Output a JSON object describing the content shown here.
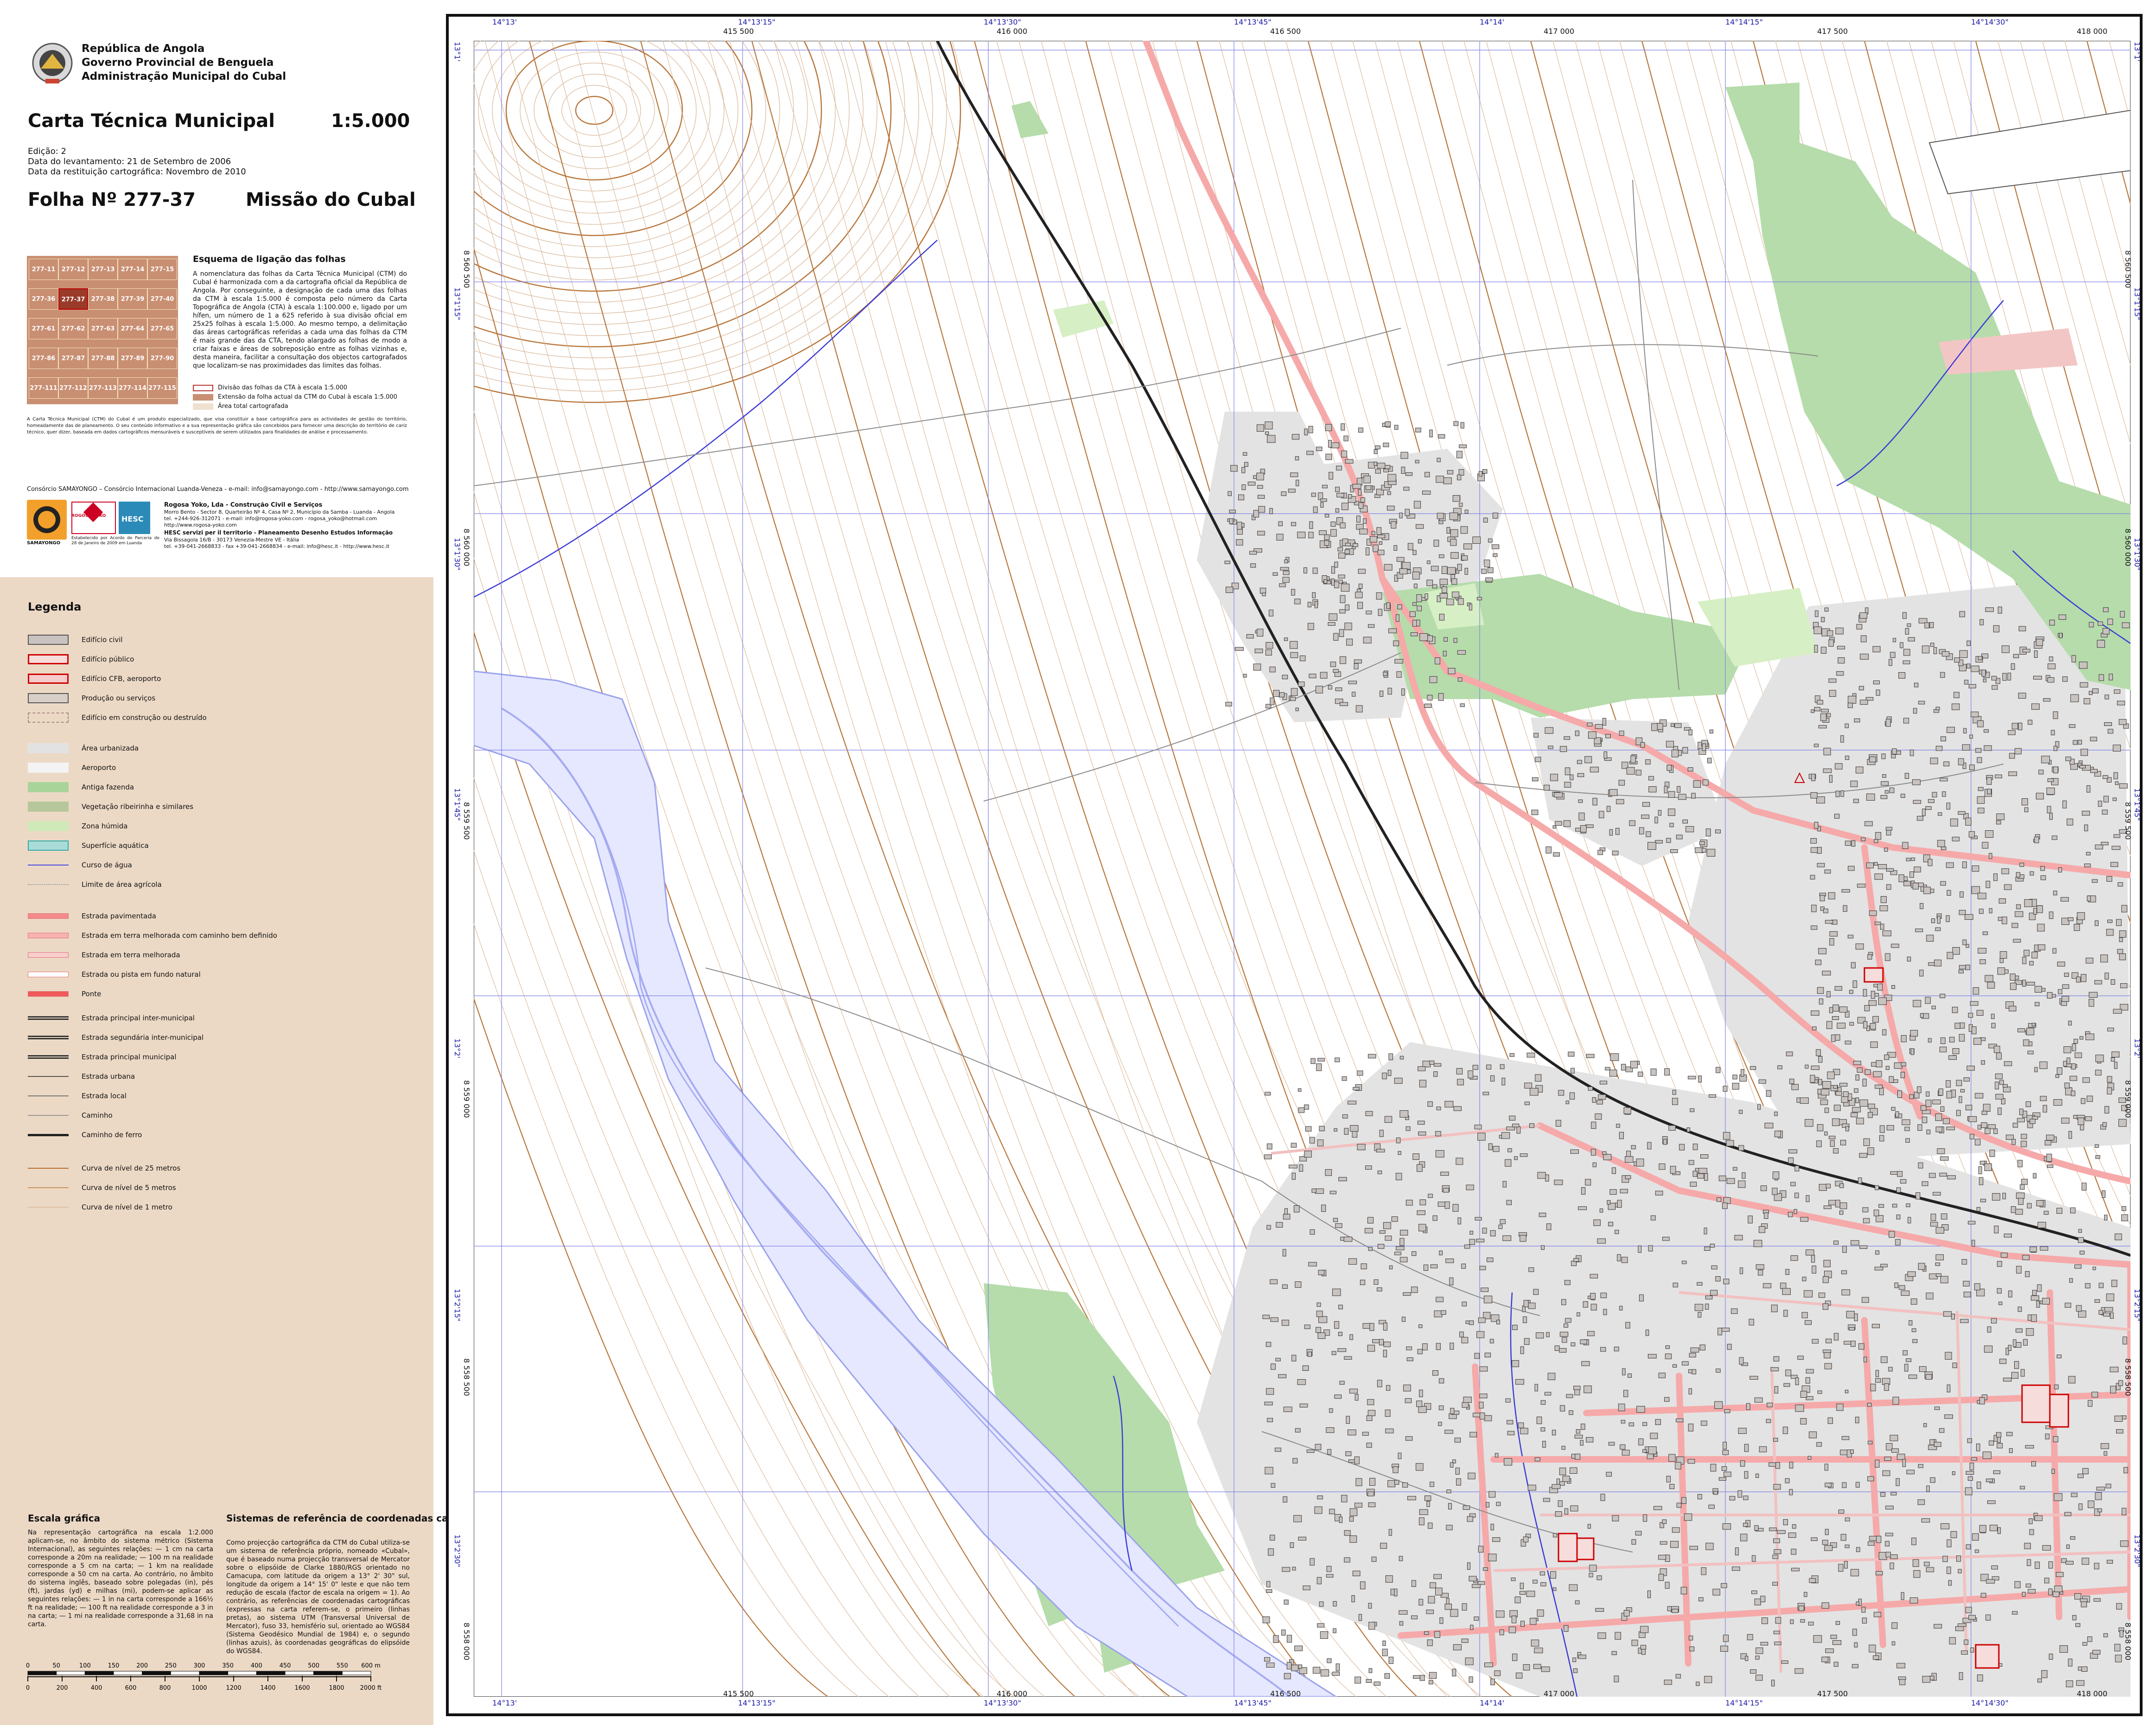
{
  "header": {
    "republic": "República de Angola",
    "government": "Governo Provincial de Benguela",
    "administration": "Administração Municipal do Cubal",
    "map_title": "Carta Técnica Municipal",
    "scale": "1:5.000",
    "edition": "Edição: 2",
    "survey_date": "Data do levantamento: 21 de Setembro de 2006",
    "restitution_date": "Data da restituição cartográfica: Novembro de 2010",
    "sheet_label": "Folha Nº  277-37",
    "sheet_name": "Missão do Cubal"
  },
  "index_scheme": {
    "title": "Esquema de ligação das folhas",
    "rows": [
      [
        "277-11",
        "277-12",
        "277-13",
        "277-14",
        "277-15"
      ],
      [
        "277-36",
        "277-37",
        "277-38",
        "277-39",
        "277-40"
      ],
      [
        "277-61",
        "277-62",
        "277-63",
        "277-64",
        "277-65"
      ],
      [
        "277-86",
        "277-87",
        "277-88",
        "277-89",
        "277-90"
      ],
      [
        "277-111",
        "277-112",
        "277-113",
        "277-114",
        "277-115"
      ]
    ],
    "description": "A nomenclatura das folhas da Carta Técnica Municipal (CTM) do Cubal é harmonizada com a da cartografia oficial da República de Angola. Por conseguinte, a designação de cada uma das folhas da CTM à escala 1:5.000 é composta pelo número da Carta Topográfica de Angola (CTA) à escala 1:100.000 e, ligado por um hífen, um número de 1 a 625 referido à sua divisão oficial em 25x25 folhas à escala 1:5.000. Ao mesmo tempo, a delimitação das áreas cartográficas referidas a cada uma das folhas da CTM é mais grande das da CTA, tendo alargado as folhas de modo a criar faixas e áreas de sobreposição entre as folhas vizinhas e, desta maneira, facilitar a consultação dos objectos cartografados que localizam-se nas proximidades das limites das folhas.",
    "key": [
      "Divisão das folhas da CTA à escala 1:5.000",
      "Extensão da folha actual da CTM do Cubal à escala 1:5.000",
      "Área total cartografada"
    ]
  },
  "notes": {
    "credits_paragraph": "A Carta Técnica Municipal (CTM) do Cubal é um produto especializado, que visa constituir a base cartográfica para as actividades de gestão do território, homeadamente das de planeamento. O seu conteúdo informativo e a sua representação gráfica são concebidos para fornecer uma descrição do território de cariz técnico, quer dizer, baseada em dados cartográficos mensuráveis e susceptíveis de serem utilizados para finalidades de análise e processamento.",
    "consortium": "Consórcio SAMAYONGO – Consórcio Internacional Luanda-Veneza - e-mail: info@samayongo.com - http://www.samayongo.com",
    "company1_title": "Rogosa Yoko, Lda - Construção Civil e Serviços",
    "company1_lines": [
      "Morro Bento - Sector 8, Quarteirão Nº 4, Casa Nº 2, Município da Samba - Luanda - Angola",
      "tel. +244-926-312071 - e-mail: info@rogosa-yoko.com - rogosa_yoko@hotmail.com",
      "http://www.rogosa-yoko.com"
    ],
    "company2_title": "HESC servizi per il territorio - Planeamento Desenho Estudos Informação",
    "company2_lines": [
      "Via Bissagola 16/B - 30173 Venezia-Mestre VE - Itália",
      "tel. +39-041-2668833 - fax +39-041-2668834 - e-mail: info@hesc.it - http://www.hesc.it"
    ],
    "logo_samayongo": "SAMAYONGO",
    "logo_rogosa": "ROGOSA YOKO",
    "logo_hesc": "HESC",
    "consortium_note": "Estabelecido por Acordo de Parceria de 28 de Janeiro de 2009 em Luanda"
  },
  "legend": {
    "title": "Legenda",
    "items": [
      {
        "label": "Edifício civil",
        "color": "#c8c3c0",
        "style": "box"
      },
      {
        "label": "Edifício público",
        "color": "#f7dcdc",
        "style": "box-red"
      },
      {
        "label": "Edifício CFB, aeroporto",
        "color": "#f5cccc",
        "style": "box-red-hatch"
      },
      {
        "label": "Produção ou serviços",
        "color": "#d8cfc8",
        "style": "box-hatch"
      },
      {
        "label": "Edifício em construção ou destruído",
        "color": "#ecd9c5",
        "style": "box-dash"
      },
      {
        "label": "Área urbanizada",
        "color": "#e2e2e2",
        "style": "fill"
      },
      {
        "label": "Aeroporto",
        "color": "#f3f3f3",
        "style": "fill"
      },
      {
        "label": "Antiga fazenda",
        "color": "#a8d49a",
        "style": "fill"
      },
      {
        "label": "Vegetação ribeirinha e similares",
        "color": "#b7c79c",
        "style": "fill"
      },
      {
        "label": "Zona húmida",
        "color": "#cfe9b8",
        "style": "fill"
      },
      {
        "label": "Superfície aquática",
        "color": "#a9dcd8",
        "style": "fill-blue"
      },
      {
        "label": "Curso de água",
        "color": "#4a4ae0",
        "style": "line"
      },
      {
        "label": "Limite de área agrícola",
        "color": "#9a9a9a",
        "style": "line-dot"
      },
      {
        "label": "Estrada pavimentada",
        "color": "#f58a8a",
        "style": "road"
      },
      {
        "label": "Estrada em terra melhorada com caminho bem definido",
        "color": "#f7b2b2",
        "style": "road"
      },
      {
        "label": "Estrada em terra melhorada",
        "color": "#f8cdcd",
        "style": "road"
      },
      {
        "label": "Estrada ou pista em fundo natural",
        "color": "#ffffff",
        "style": "road"
      },
      {
        "label": "Ponte",
        "color": "#f05a5a",
        "style": "road"
      },
      {
        "label": "Estrada principal inter-municipal",
        "color": "#333333",
        "style": "line-double"
      },
      {
        "label": "Estrada segundária inter-municipal",
        "color": "#333333",
        "style": "line-double"
      },
      {
        "label": "Estrada principal municipal",
        "color": "#333333",
        "style": "line-double"
      },
      {
        "label": "Estrada urbana",
        "color": "#555555",
        "style": "line"
      },
      {
        "label": "Estrada local",
        "color": "#777777",
        "style": "line"
      },
      {
        "label": "Caminho",
        "color": "#999999",
        "style": "line"
      },
      {
        "label": "Caminho de ferro",
        "color": "#222222",
        "style": "line-thick"
      },
      {
        "label": "Curva de nível de 25 metros",
        "color": "#b86a2a",
        "style": "line"
      },
      {
        "label": "Curva de nível de 5 metros",
        "color": "#c9935f",
        "style": "line"
      },
      {
        "label": "Curva de nível de 1 metro",
        "color": "#ddbfa0",
        "style": "line"
      }
    ]
  },
  "scale_bar": {
    "title": "Escala gráfica",
    "text": "Na representação cartográfica na escala 1:2.000 aplicam-se, no âmbito do sistema métrico (Sistema Internacional), as seguintes relações: — 1 cm na carta corresponde a 20m na realidade; — 100 m na realidade corresponde a 5 cm na carta; — 1 km na realidade corresponde a 50 cm na carta. Ao contrário, no âmbito do sistema inglês, baseado sobre polegadas (in), pés (ft), jardas (yd) e milhas (mi), podem-se aplicar as seguintes relações: — 1 in na carta corresponde a 166½ ft na realidade; — 100 ft na realidade corresponde a 3 in na carta; — 1 mi na realidade corresponde a 31,68 in na carta.",
    "meters_ticks": [
      "0",
      "50",
      "100",
      "150",
      "200",
      "250",
      "300",
      "350",
      "400",
      "450",
      "500",
      "550",
      "600 m"
    ],
    "feet_ticks": [
      "0",
      "200",
      "400",
      "600",
      "800",
      "1000",
      "1200",
      "1400",
      "1600",
      "1800",
      "2000 ft"
    ]
  },
  "reference_systems": {
    "title": "Sistemas de referência de coordenadas cartográficas",
    "text": "Como projecção cartográfica da CTM do Cubal utiliza-se um sistema de referência próprio, nomeado «Cubal», que é baseado numa projecção transversal de Mercator sobre o elipsóide de Clarke 1880/RGS orientado no Camacupa, com latitude da origem a 13° 2' 30\" sul, longitude da origem a 14° 15' 0\" leste e que não tem redução de escala (factor de escala na origem = 1). Ao contrário, as referências de coordenadas cartográficas (expressas na carta referem-se, o primeiro (linhas pretas), ao sistema UTM (Transversal Universal de Mercator), fuso 33, hemisfério sul, orientado ao WGS84 (Sistema Geodésico Mundial de 1984) e, o segundo (linhas azuis), às coordenadas geográficas do elipsóide do WGS84."
  },
  "map": {
    "top_geo": [
      "14°13'",
      "14°13'15\"",
      "14°13'30\"",
      "14°13'45\"",
      "14°14'",
      "14°14'15\"",
      "14°14'30\""
    ],
    "top_utm": [
      "415 500",
      "416 000",
      "416 500",
      "417 000",
      "417 500",
      "418 000"
    ],
    "left_geo": [
      "13°1'",
      "13°1'15\"",
      "13°1'30\"",
      "13°1'45\"",
      "13°2'",
      "13°2'15\"",
      "13°2'30\""
    ],
    "left_utm": [
      "8 560 500",
      "8 560 000",
      "8 559 500",
      "8 559 000",
      "8 558 500",
      "8 558 000"
    ],
    "colors": {
      "farm": "#b5dcaa",
      "wetland": "#d6efc4",
      "urban": "#e3e3e3",
      "road": "#f6a9a9",
      "contour_major": "#b9763b",
      "contour_minor": "#d8b595",
      "water": "#3b3bd6",
      "river_fill": "#e6e8ff",
      "grid_blue": "#8080e6"
    }
  }
}
